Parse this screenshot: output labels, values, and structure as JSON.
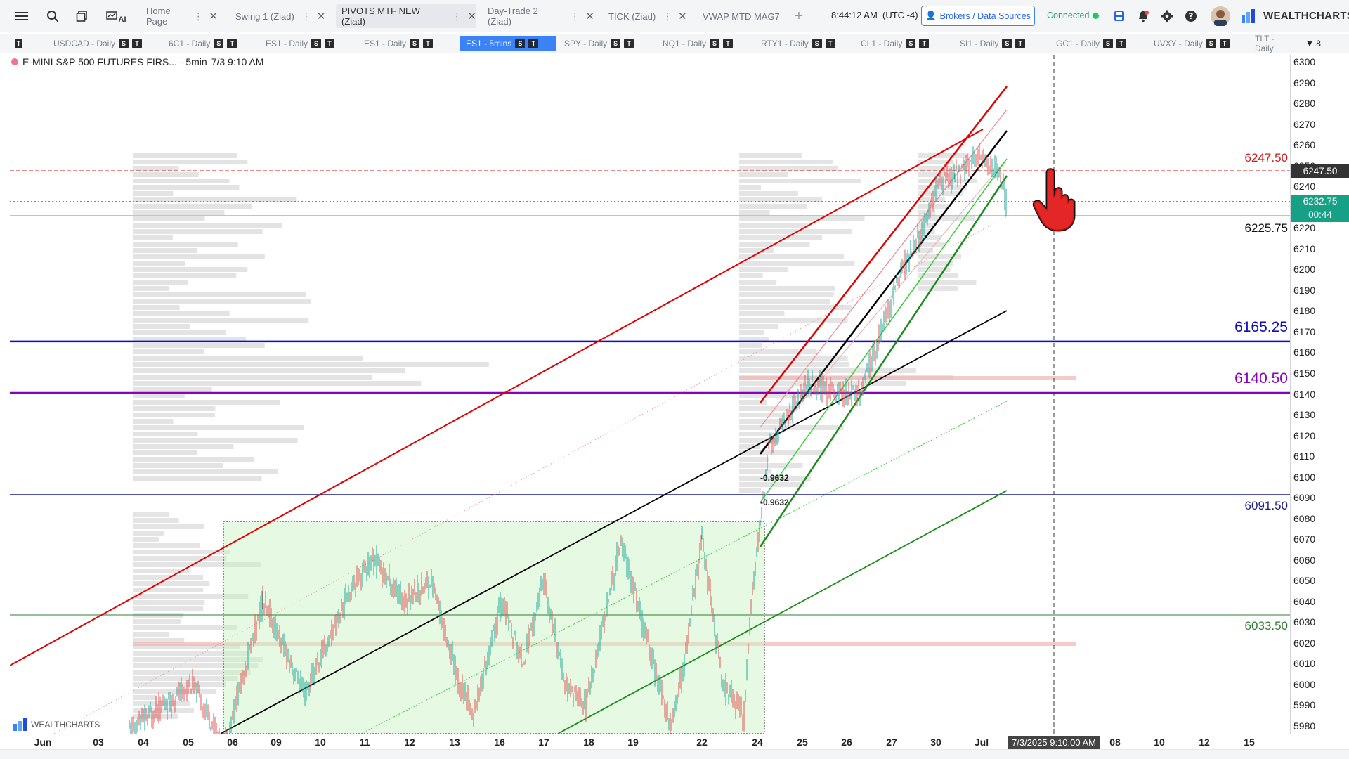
{
  "workspace_tabs": [
    {
      "label": "Home Page",
      "active": false
    },
    {
      "label": "Swing 1 (Ziad)",
      "active": false
    },
    {
      "label": "PIVOTS MTF NEW (Ziad)",
      "active": true
    },
    {
      "label": "Day-Trade 2 (Ziad)",
      "active": false
    },
    {
      "label": "TICK (Ziad)",
      "active": false
    },
    {
      "label": "VWAP MTD MAG7",
      "active": false
    }
  ],
  "header": {
    "ai_label": "AI",
    "clock": "8:44:12 AM",
    "timezone": "(UTC -4)",
    "brokers_label": "Brokers / Data Sources",
    "status": "Connected",
    "brand": "WEALTHCHARTS"
  },
  "symbol_tabs": [
    {
      "label": "USDCAD - Daily",
      "active": false
    },
    {
      "label": "6C1 - Daily",
      "active": false
    },
    {
      "label": "ES1 - Daily",
      "active": false
    },
    {
      "label": "ES1 - Daily",
      "active": false
    },
    {
      "label": "ES1 - 5mins",
      "active": true
    },
    {
      "label": "SPY - Daily",
      "active": false
    },
    {
      "label": "NQ1 - Daily",
      "active": false
    },
    {
      "label": "RTY1 - Daily",
      "active": false
    },
    {
      "label": "CL1 - Daily",
      "active": false
    },
    {
      "label": "SI1 - Daily",
      "active": false
    },
    {
      "label": "GC1 - Daily",
      "active": false
    },
    {
      "label": "UVXY - Daily",
      "active": false
    },
    {
      "label": "TLT - Daily",
      "active": false
    }
  ],
  "badges": {
    "s": "S",
    "t": "T"
  },
  "more_tabs_count": "8",
  "legend": {
    "title": "E-MINI S&P 500 FUTURES FIRS... - 5min",
    "datetime": "7/3 9:10 AM"
  },
  "watermark": "WEALTHCHARTS",
  "colors": {
    "red_line": "#e00000",
    "black_line": "#000000",
    "green_line": "#1a8a1a",
    "lime_line": "#33cc33",
    "blue_level": "#1010c0",
    "purple_level": "#8a00c0",
    "last_price": "#16a085",
    "crosshair_price": "#333333"
  },
  "chart_data": {
    "type": "candlestick",
    "title": "",
    "y_ticks": [
      6300,
      6290,
      6280,
      6270,
      6260,
      6250,
      6240,
      6230,
      6220,
      6210,
      6200,
      6190,
      6180,
      6170,
      6160,
      6150,
      6140,
      6130,
      6120,
      6110,
      6100,
      6090,
      6080,
      6070,
      6060,
      6050,
      6040,
      6030,
      6020,
      6010,
      6000,
      5990,
      5980
    ],
    "ylim": [
      5975,
      6305
    ],
    "x_ticks": [
      "Jun",
      "03",
      "04",
      "05",
      "06",
      "09",
      "10",
      "11",
      "12",
      "13",
      "16",
      "17",
      "18",
      "19",
      "22",
      "24",
      "25",
      "26",
      "27",
      "30",
      "Jul",
      "08",
      "10",
      "12",
      "15"
    ],
    "crosshair": {
      "price": "6247.50",
      "time": "7/3/2025 9:10:00 AM"
    },
    "last_price": {
      "value": "6232.75",
      "countdown": "00:44"
    },
    "levels": [
      {
        "value": "6247.50",
        "color": "#d01818"
      },
      {
        "value": "6225.75",
        "color": "#111111"
      },
      {
        "value": "6165.25",
        "color": "#1010c0"
      },
      {
        "value": "6140.50",
        "color": "#8a00c0"
      },
      {
        "value": "6091.50",
        "color": "#1a1a8a"
      },
      {
        "value": "6033.50",
        "color": "#2e7d32"
      }
    ],
    "annotations": [
      "-0.9632",
      "-0.9632"
    ]
  }
}
